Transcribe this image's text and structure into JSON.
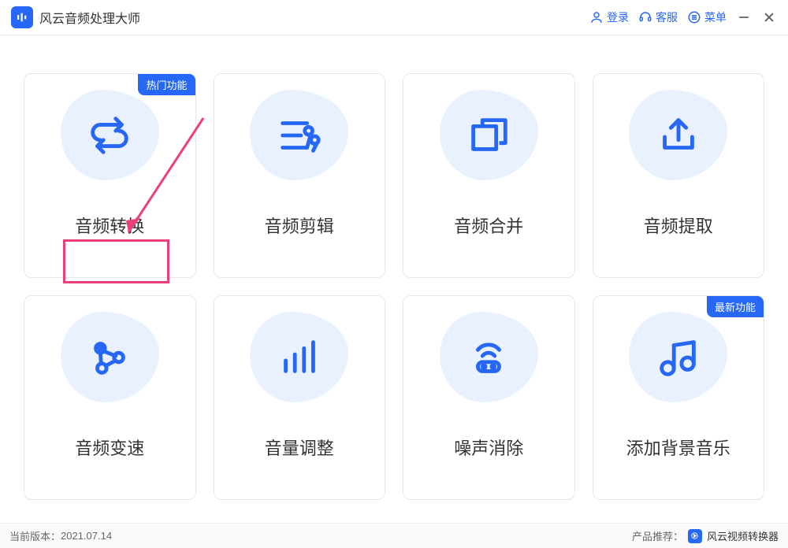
{
  "app": {
    "title": "风云音频处理大师"
  },
  "titlebar": {
    "login": "登录",
    "service": "客服",
    "menu": "菜单"
  },
  "badges": {
    "hot": "热门功能",
    "new": "最新功能"
  },
  "cards": [
    {
      "label": "音频转换"
    },
    {
      "label": "音频剪辑"
    },
    {
      "label": "音频合并"
    },
    {
      "label": "音频提取"
    },
    {
      "label": "音频变速"
    },
    {
      "label": "音量调整"
    },
    {
      "label": "噪声消除"
    },
    {
      "label": "添加背景音乐"
    }
  ],
  "footer": {
    "version_label": "当前版本：",
    "version": "2021.07.14",
    "recommend_label": "产品推荐：",
    "recommend_product": "风云视频转换器"
  }
}
